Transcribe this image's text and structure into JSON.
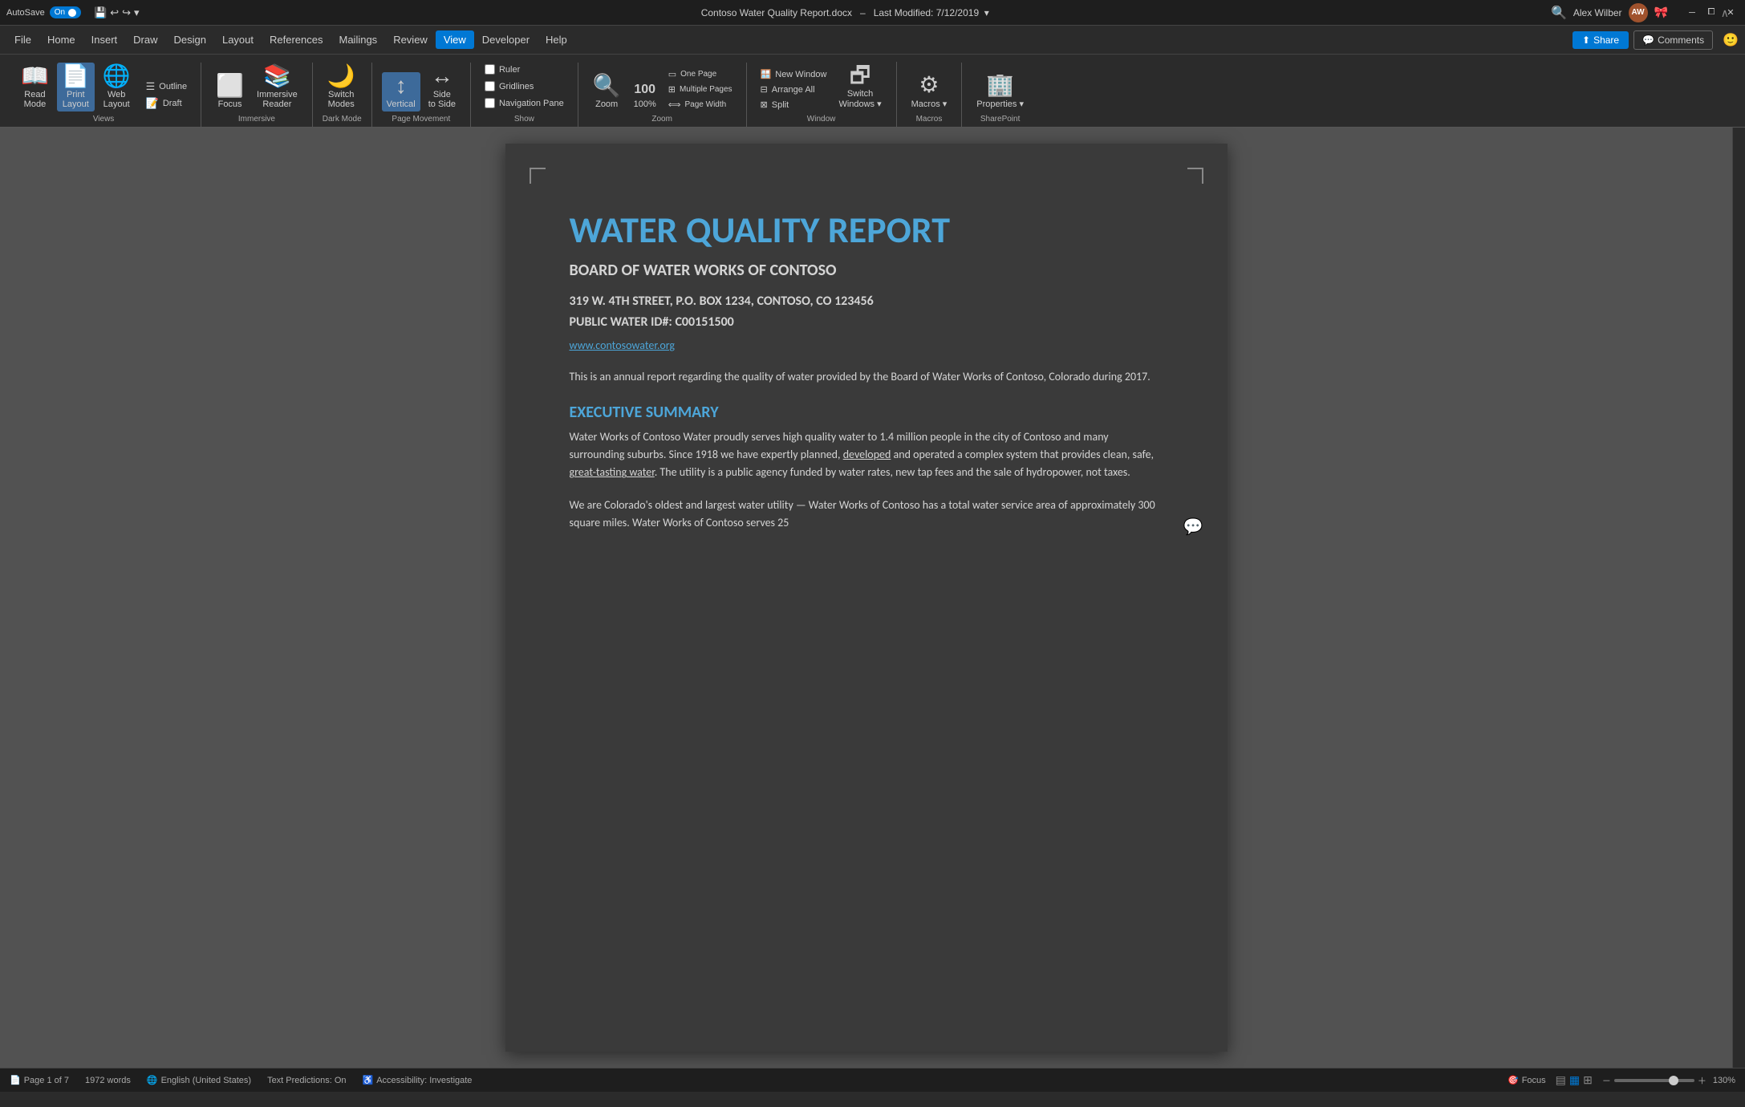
{
  "titlebar": {
    "autosave_label": "AutoSave",
    "autosave_state": "On",
    "filename": "Contoso Water Quality Report.docx",
    "last_modified": "Last Modified: 7/12/2019",
    "user_name": "Alex Wilber",
    "user_initials": "AW",
    "undo_icon": "↩",
    "redo_icon": "↪"
  },
  "menu": {
    "items": [
      "File",
      "Home",
      "Insert",
      "Draw",
      "Design",
      "Layout",
      "References",
      "Mailings",
      "Review",
      "View",
      "Developer",
      "Help"
    ],
    "active": "View",
    "share_label": "Share",
    "comments_label": "Comments"
  },
  "ribbon": {
    "groups": [
      {
        "label": "Views",
        "items": [
          {
            "id": "read-mode",
            "label": "Read Mode",
            "icon": "📖"
          },
          {
            "id": "print-layout",
            "label": "Print Layout",
            "icon": "📄"
          },
          {
            "id": "web-layout",
            "label": "Web Layout",
            "icon": "🌐"
          }
        ],
        "sub_items": [
          {
            "id": "outline",
            "label": "Outline"
          },
          {
            "id": "draft",
            "label": "Draft"
          }
        ]
      },
      {
        "label": "Immersive",
        "items": [
          {
            "id": "focus",
            "label": "Focus",
            "icon": "⬜"
          },
          {
            "id": "immersive-reader",
            "label": "Immersive Reader",
            "icon": "📚"
          }
        ]
      },
      {
        "label": "Dark Mode",
        "items": [
          {
            "id": "switch-modes",
            "label": "Switch Modes",
            "icon": "🌙"
          }
        ]
      },
      {
        "label": "Page Movement",
        "items": [
          {
            "id": "vertical",
            "label": "Vertical",
            "icon": "↕"
          },
          {
            "id": "side-to-side",
            "label": "Side to Side",
            "icon": "↔"
          }
        ]
      },
      {
        "label": "Show",
        "checkboxes": [
          {
            "id": "ruler",
            "label": "Ruler",
            "checked": false
          },
          {
            "id": "gridlines",
            "label": "Gridlines",
            "checked": false
          },
          {
            "id": "navigation-pane",
            "label": "Navigation Pane",
            "checked": false
          }
        ]
      },
      {
        "label": "Zoom",
        "items": [
          {
            "id": "zoom",
            "label": "Zoom",
            "icon": "🔍"
          },
          {
            "id": "zoom-100",
            "label": "100%",
            "icon": "100"
          },
          {
            "id": "zoom-controls",
            "label": "",
            "icon": "⊞"
          }
        ]
      },
      {
        "label": "Window",
        "items": [
          {
            "id": "new-window",
            "label": "New Window"
          },
          {
            "id": "arrange-all",
            "label": "Arrange All"
          },
          {
            "id": "split",
            "label": "Split"
          },
          {
            "id": "switch-windows",
            "label": "Switch Windows",
            "icon": "🪟"
          }
        ]
      },
      {
        "label": "Macros",
        "items": [
          {
            "id": "macros",
            "label": "Macros",
            "icon": "⚙"
          }
        ]
      },
      {
        "label": "SharePoint",
        "items": [
          {
            "id": "properties",
            "label": "Properties",
            "icon": "🏢"
          }
        ]
      }
    ]
  },
  "document": {
    "title": "WATER QUALITY REPORT",
    "subtitle": "BOARD OF WATER WORKS OF CONTOSO",
    "address_line1": "319 W. 4TH STREET, P.O. BOX 1234, CONTOSO, CO 123456",
    "address_line2": "PUBLIC WATER ID#: C00151500",
    "website": "www.contosowater.org",
    "intro": "This is an annual report regarding the quality of water provided by the Board of Water Works of Contoso, Colorado during 2017.",
    "executive_summary_title": "EXECUTIVE SUMMARY",
    "executive_summary_p1": "Water Works of Contoso Water proudly serves high quality water to 1.4 million people in the city of Contoso and many surrounding suburbs. Since 1918 we have expertly planned, developed and operated a complex system that provides clean, safe, great-tasting water. The utility is a public agency funded by water rates, new tap fees and the sale of hydropower, not taxes.",
    "executive_summary_p2": "We are Colorado's oldest and largest water utility — Water Works of Contoso has a total water service area of approximately 300 square miles. Water Works of Contoso serves 25"
  },
  "statusbar": {
    "page_info": "Page 1 of 7",
    "word_count": "1972 words",
    "language": "English (United States)",
    "text_predictions": "Text Predictions: On",
    "accessibility": "Accessibility: Investigate",
    "focus_label": "Focus",
    "zoom_level": "130%",
    "view_icons": [
      "≡",
      "▤",
      "▦"
    ]
  }
}
